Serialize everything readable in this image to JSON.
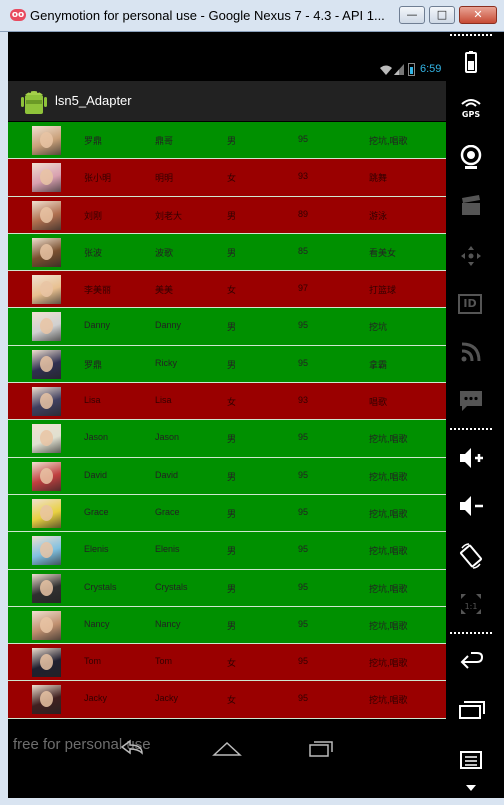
{
  "window": {
    "title": "Genymotion for personal use - Google Nexus 7 - 4.3 - API 1...",
    "icon_text": "oo",
    "minimize_glyph": "—",
    "maximize_glyph": "□",
    "close_glyph": "✕"
  },
  "status_bar": {
    "time": "6:59"
  },
  "action_bar": {
    "title": "lsn5_Adapter"
  },
  "list_rows": [
    {
      "color": "green",
      "name": "罗鼎",
      "nick": "鼎哥",
      "gender": "男",
      "score": "95",
      "hobby": "挖坑,唱歌",
      "avatar": "#c9a07a"
    },
    {
      "color": "red",
      "name": "张小明",
      "nick": "明明",
      "gender": "女",
      "score": "93",
      "hobby": "跳舞",
      "avatar": "#d8a0b0"
    },
    {
      "color": "red",
      "name": "刘刚",
      "nick": "刘老大",
      "gender": "男",
      "score": "89",
      "hobby": "游泳",
      "avatar": "#b07050"
    },
    {
      "color": "green",
      "name": "张波",
      "nick": "波歌",
      "gender": "男",
      "score": "85",
      "hobby": "看美女",
      "avatar": "#7a5030"
    },
    {
      "color": "red",
      "name": "李美丽",
      "nick": "美美",
      "gender": "女",
      "score": "97",
      "hobby": "打篮球",
      "avatar": "#e8c090"
    },
    {
      "color": "green",
      "name": "Danny",
      "nick": "Danny",
      "gender": "男",
      "score": "95",
      "hobby": "挖坑",
      "avatar": "#d0d0d0"
    },
    {
      "color": "green",
      "name": "罗鼎",
      "nick": "Ricky",
      "gender": "男",
      "score": "95",
      "hobby": "拿霸",
      "avatar": "#303050"
    },
    {
      "color": "red",
      "name": "Lisa",
      "nick": "Lisa",
      "gender": "女",
      "score": "93",
      "hobby": "唱歌",
      "avatar": "#404060"
    },
    {
      "color": "green",
      "name": "Jason",
      "nick": "Jason",
      "gender": "男",
      "score": "95",
      "hobby": "挖坑,唱歌",
      "avatar": "#e0e0d0"
    },
    {
      "color": "green",
      "name": "David",
      "nick": "David",
      "gender": "男",
      "score": "95",
      "hobby": "挖坑,唱歌",
      "avatar": "#c04040"
    },
    {
      "color": "green",
      "name": "Grace",
      "nick": "Grace",
      "gender": "男",
      "score": "95",
      "hobby": "挖坑,唱歌",
      "avatar": "#e8d040"
    },
    {
      "color": "green",
      "name": "Elenis",
      "nick": "Elenis",
      "gender": "男",
      "score": "95",
      "hobby": "挖坑,唱歌",
      "avatar": "#80c0e0"
    },
    {
      "color": "green",
      "name": "Crystals",
      "nick": "Crystals",
      "gender": "男",
      "score": "95",
      "hobby": "挖坑,唱歌",
      "avatar": "#303030"
    },
    {
      "color": "green",
      "name": "Nancy",
      "nick": "Nancy",
      "gender": "男",
      "score": "95",
      "hobby": "挖坑,唱歌",
      "avatar": "#c09070"
    },
    {
      "color": "red",
      "name": "Tom",
      "nick": "Tom",
      "gender": "女",
      "score": "95",
      "hobby": "挖坑,唱歌",
      "avatar": "#202030"
    },
    {
      "color": "red",
      "name": "Jacky",
      "nick": "Jacky",
      "gender": "女",
      "score": "95",
      "hobby": "挖坑,唱歌",
      "avatar": "#402020"
    }
  ],
  "nav_bar": {
    "watermark": "free for personal use"
  },
  "side_toolbar": {
    "gps_label": "GPS",
    "id_label": "ID",
    "scale_label": "1:1"
  },
  "colors": {
    "row_green": "#009000",
    "row_red": "#9a0000",
    "clock": "#33b5e5"
  }
}
